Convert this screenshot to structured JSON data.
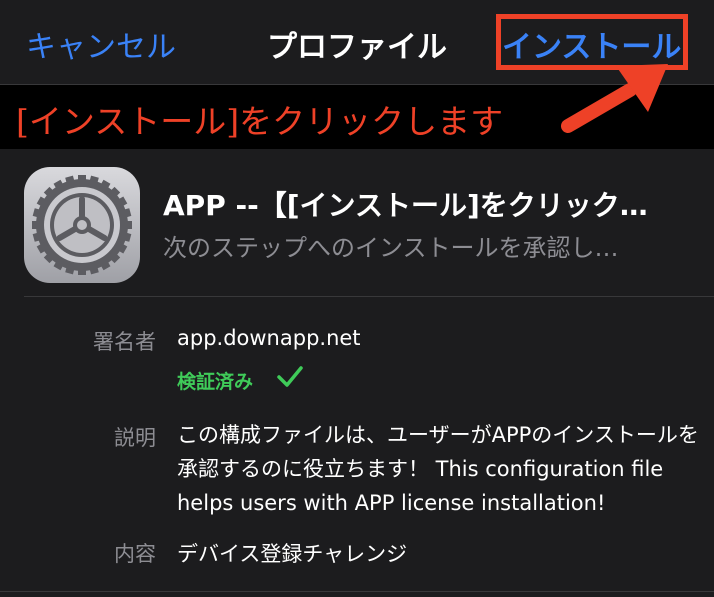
{
  "nav": {
    "cancel_label": "キャンセル",
    "title": "プロファイル",
    "install_label": "インストール"
  },
  "annotation": {
    "text": "[インストール]をクリックします",
    "color": "#ee4127"
  },
  "profile": {
    "icon": "settings-gear-icon",
    "title": "APP --【[インストール]をクリック…",
    "subtitle": "次のステップへのインストールを承認し…"
  },
  "details": {
    "signer_label": "署名者",
    "signer_value": "app.downapp.net",
    "verified_label": "検証済み",
    "description_label": "説明",
    "description_value": "この構成ファイルは、ユーザーがAPPのインストールを承認するのに役立ちます！ This configuration file helps users with APP license installation!",
    "contents_label": "内容",
    "contents_value": "デバイス登録チャレンジ"
  },
  "colors": {
    "accent": "#3a82f7",
    "verified": "#3fcb59",
    "highlight": "#ee4127"
  }
}
